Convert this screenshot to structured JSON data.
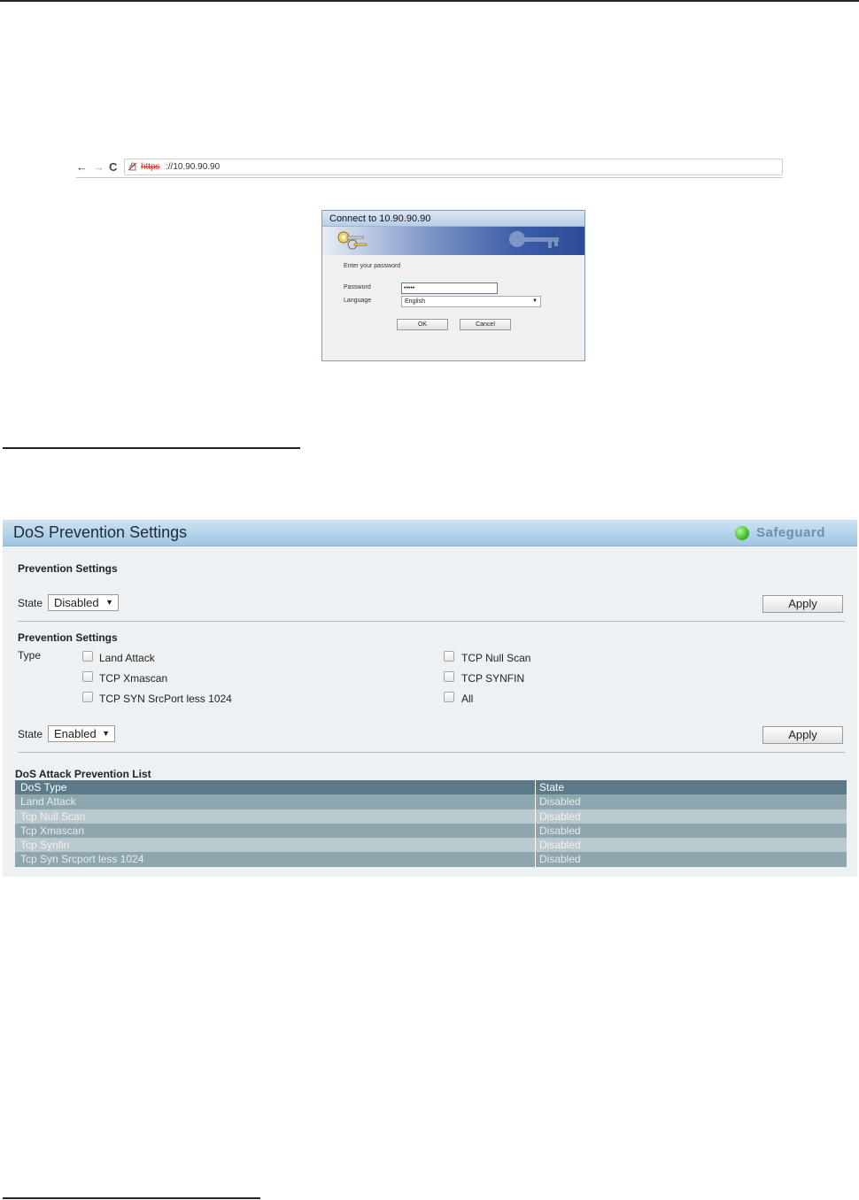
{
  "browser": {
    "back_glyph": "←",
    "forward_glyph": "→",
    "reload_glyph": "C",
    "url_scheme": "https",
    "url_rest": "://10.90.90.90"
  },
  "login_dialog": {
    "title": "Connect to 10.90.90.90",
    "prompt": "Enter your password",
    "password_label": "Password",
    "password_value": "•••••",
    "language_label": "Language",
    "language_value": "English",
    "ok_label": "OK",
    "cancel_label": "Cancel"
  },
  "panel": {
    "title": "DoS Prevention Settings",
    "safeguard_label": "Safeguard",
    "section1": {
      "title": "Prevention Settings",
      "state_label": "State",
      "state_value": "Disabled",
      "apply_label": "Apply"
    },
    "section2": {
      "title": "Prevention Settings",
      "type_label": "Type",
      "checkboxes": [
        "Land Attack",
        "TCP Xmascan",
        "TCP SYN SrcPort less 1024",
        "TCP Null Scan",
        "TCP SYNFIN",
        "All"
      ],
      "state_label": "State",
      "state_value": "Enabled",
      "apply_label": "Apply"
    },
    "list": {
      "title": "DoS Attack Prevention List",
      "columns": [
        "DoS Type",
        "State"
      ],
      "rows": [
        [
          "Land Attack",
          "Disabled"
        ],
        [
          "Tcp Null Scan",
          "Disabled"
        ],
        [
          "Tcp Xmascan",
          "Disabled"
        ],
        [
          "Tcp Synfin",
          "Disabled"
        ],
        [
          "Tcp Syn Srcport less 1024",
          "Disabled"
        ]
      ]
    }
  },
  "colors": {
    "header_gradient_top": "#cfe3f2",
    "header_gradient_bottom": "#9fc5e3",
    "table_header": "#5a7a8a",
    "table_row_dark": "#8ea6ae",
    "table_row_light": "#b9c9cd",
    "safeguard_indicator": "#3fbf2a"
  }
}
